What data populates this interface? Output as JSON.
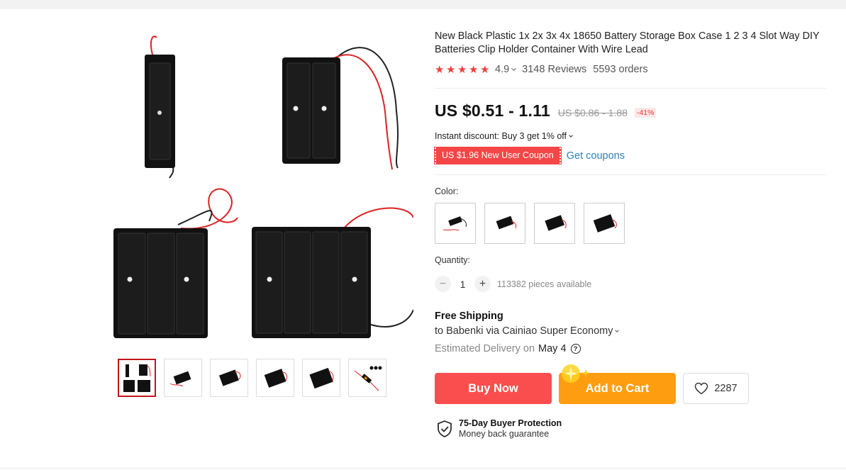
{
  "product": {
    "title": "New Black Plastic 1x 2x 3x 4x 18650 Battery Storage Box Case 1 2 3 4 Slot Way DIY Batteries Clip Holder Container With Wire Lead",
    "rating": "4.9",
    "rating_stars": 5,
    "reviews": "3148 Reviews",
    "orders": "5593 orders"
  },
  "pricing": {
    "price": "US $0.51 - 1.11",
    "original_price": "US $0.86 - 1.88",
    "discount": "-41%",
    "instant_discount": "Instant discount: Buy 3 get 1% off",
    "coupon": "US $1.96 New User Coupon",
    "get_coupons": "Get coupons"
  },
  "options": {
    "color_label": "Color:",
    "color_count": 4,
    "quantity_label": "Quantity:",
    "quantity": "1",
    "minus": "−",
    "plus": "+",
    "available": "113382 pieces available"
  },
  "shipping": {
    "title": "Free Shipping",
    "to": "to Babenki via Cainiao Super Economy",
    "estimated_label": "Estimated Delivery on",
    "date": "May 4",
    "help": "?"
  },
  "actions": {
    "buy_now": "Buy Now",
    "add_to_cart": "Add to Cart",
    "wishlist_count": "2287"
  },
  "protection": {
    "title": "75-Day Buyer Protection",
    "subtitle": "Money back guarantee"
  },
  "gallery": {
    "thumbnail_count": 6,
    "active_thumbnail": 0
  },
  "colors": {
    "star": "#f23f3f",
    "buy_button": "#fa4e4e",
    "cart_button": "#ff9d11",
    "coupon": "#f44646",
    "link": "#2e7fb8",
    "active_thumb_border": "#c2161b"
  }
}
